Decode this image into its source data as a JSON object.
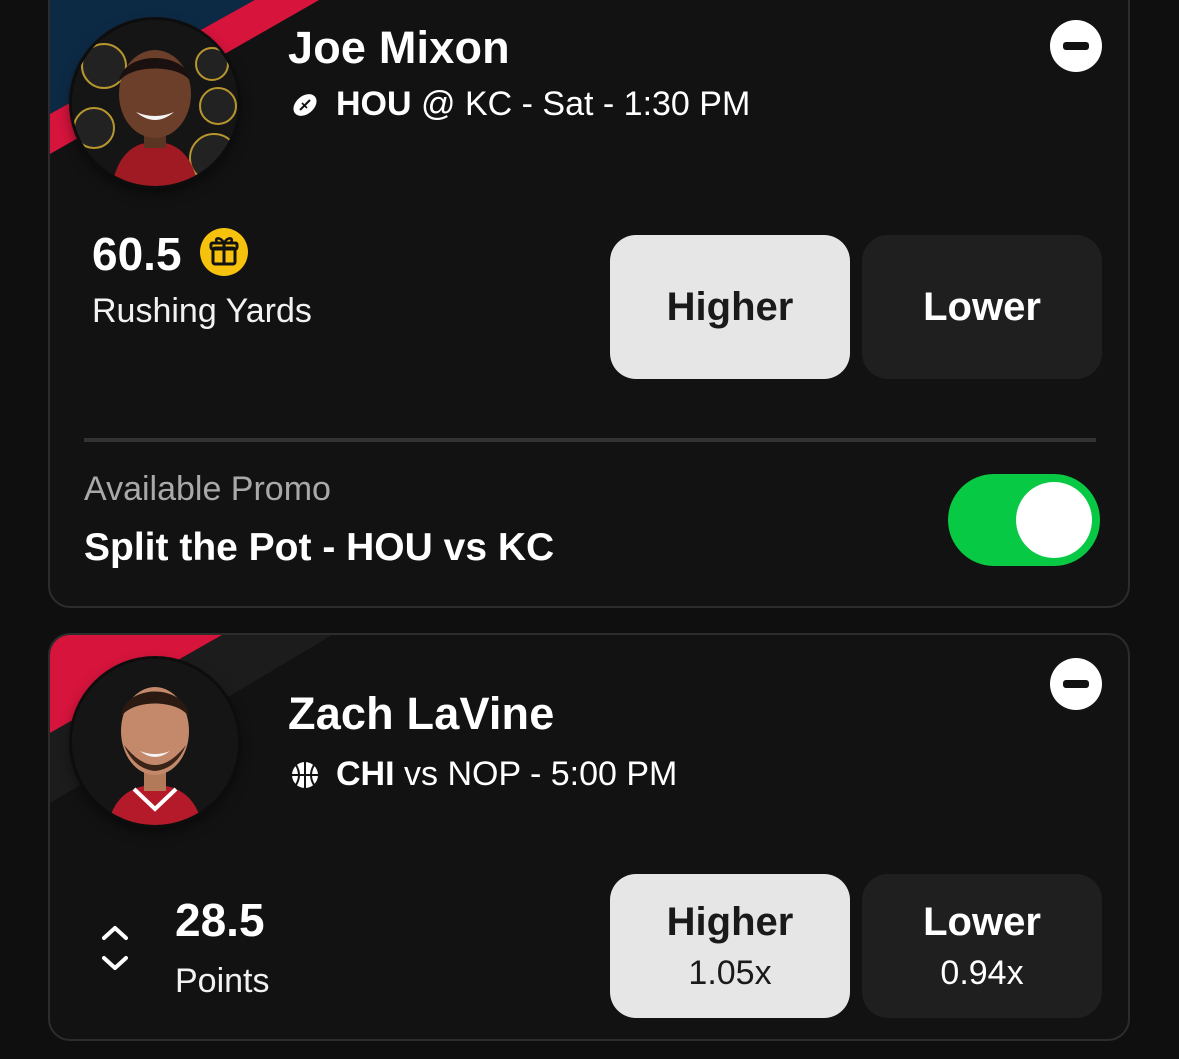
{
  "colors": {
    "background": "#0f0f0f",
    "card": "#121212",
    "accent_red": "#d6143c",
    "accent_navy": "#0d2a45",
    "promo_gift": "#f7c20e",
    "toggle_on": "#08c944",
    "selected_button": "#e6e6e6",
    "unselected_button": "#1f1f1f"
  },
  "cards": [
    {
      "player_name": "Joe Mixon",
      "sport_icon": "football-icon",
      "team": "HOU",
      "matchup_rest": "@ KC - Sat - 1:30 PM",
      "stat_value": "60.5",
      "stat_label": "Rushing Yards",
      "has_promo_gift": true,
      "pick_higher": {
        "label": "Higher",
        "multiplier": "",
        "selected": true
      },
      "pick_lower": {
        "label": "Lower",
        "multiplier": "",
        "selected": false
      },
      "promo": {
        "caption": "Available Promo",
        "title": "Split the Pot - HOU vs KC",
        "enabled": true
      }
    },
    {
      "player_name": "Zach LaVine",
      "sport_icon": "basketball-icon",
      "team": "CHI",
      "matchup_rest": "vs NOP - 5:00 PM",
      "stat_value": "28.5",
      "stat_label": "Points",
      "pick_higher": {
        "label": "Higher",
        "multiplier": "1.05x",
        "selected": true
      },
      "pick_lower": {
        "label": "Lower",
        "multiplier": "0.94x",
        "selected": false
      }
    }
  ]
}
